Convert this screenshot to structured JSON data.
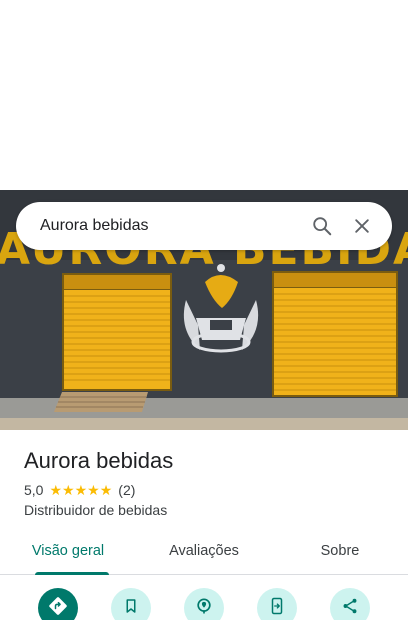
{
  "search": {
    "query": "Aurora bebidas",
    "search_icon": "search-icon",
    "close_icon": "close-icon"
  },
  "photo": {
    "sign_text": "AURORA BEBIDA"
  },
  "place": {
    "name": "Aurora bebidas",
    "rating": "5,0",
    "stars": 5,
    "review_count": "(2)",
    "category": "Distribuidor de bebidas"
  },
  "tabs": [
    {
      "label": "Visão geral",
      "active": true
    },
    {
      "label": "Avaliações",
      "active": false
    },
    {
      "label": "Sobre",
      "active": false
    }
  ],
  "actions": [
    {
      "icon": "directions-icon"
    },
    {
      "icon": "bookmark-icon"
    },
    {
      "icon": "nearby-icon"
    },
    {
      "icon": "send-to-phone-icon"
    },
    {
      "icon": "share-icon"
    }
  ],
  "colors": {
    "accent": "#00796b",
    "action_bg": "#cdf3ef",
    "star": "#fbbc04",
    "shutter": "#e8aa12"
  }
}
